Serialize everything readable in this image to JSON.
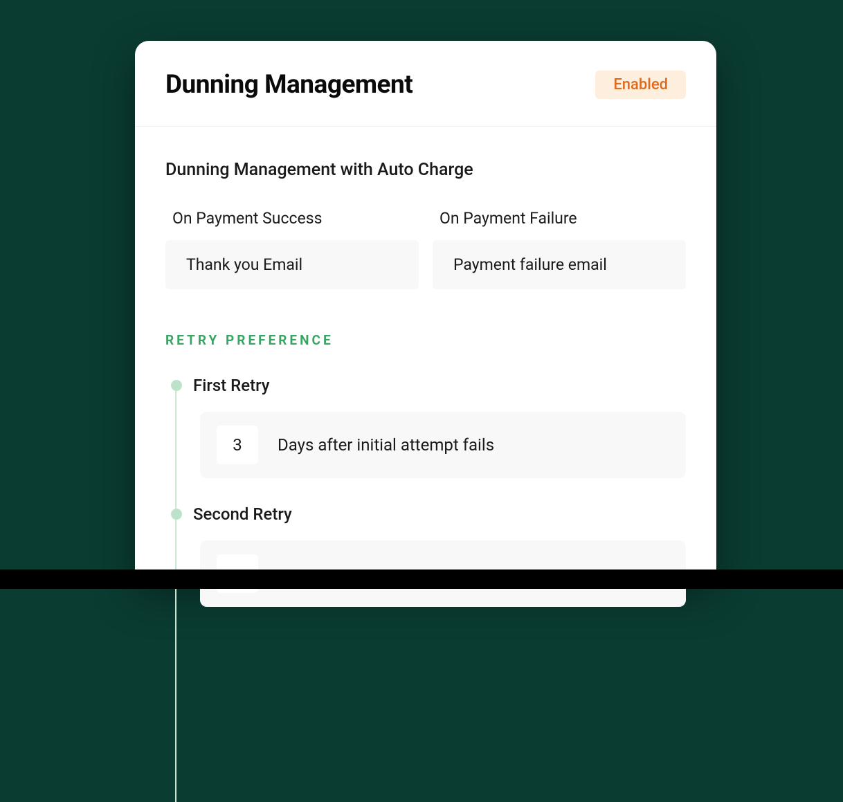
{
  "header": {
    "title": "Dunning Management",
    "status_badge": "Enabled"
  },
  "section": {
    "subtitle": "Dunning Management with Auto Charge",
    "fields": {
      "success": {
        "label": "On Payment Success",
        "value": "Thank you Email"
      },
      "failure": {
        "label": "On Payment Failure",
        "value": "Payment failure email"
      }
    }
  },
  "retry": {
    "heading": "RETRY PREFERENCE",
    "items": [
      {
        "label": "First Retry",
        "days": "3",
        "description": "Days after initial attempt fails"
      },
      {
        "label": "Second Retry",
        "days": "",
        "description": ""
      }
    ]
  }
}
